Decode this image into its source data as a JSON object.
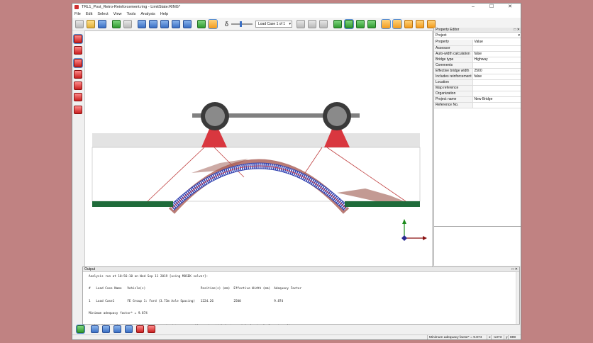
{
  "window": {
    "title": "TRL1_Post_Retro-Reinforcement.ring - LimitState:RING*",
    "controls": [
      "–",
      "☐",
      "✕"
    ]
  },
  "menu": [
    "File",
    "Edit",
    "Select",
    "View",
    "Tools",
    "Analysis",
    "Help"
  ],
  "toolbar": {
    "slider_label": "δ",
    "load_case": "Load Case 1 of 1"
  },
  "property_editor": {
    "title": "Property Editor",
    "header_controls": "□ ✕",
    "object": "Project",
    "columns": [
      "Property",
      "Value"
    ],
    "rows": [
      {
        "property": "Assessor",
        "value": ""
      },
      {
        "property": "Auto-width calculation",
        "value": "false"
      },
      {
        "property": "Bridge type",
        "value": "Highway"
      },
      {
        "property": "Comments",
        "value": ""
      },
      {
        "property": "Effective bridge width",
        "value": "2500"
      },
      {
        "property": "Includes reinforcement",
        "value": "false"
      },
      {
        "property": "Location",
        "value": ""
      },
      {
        "property": "Map reference",
        "value": ""
      },
      {
        "property": "Organization",
        "value": ""
      },
      {
        "property": "Project name",
        "value": "New Bridge"
      },
      {
        "property": "Reference No.",
        "value": ""
      }
    ]
  },
  "output": {
    "title": "Output",
    "header_controls": "□ ✕",
    "lines": [
      "Analysis run at 10:56:10 on Wed Sep 11 2019 [using MOSEK solver]:",
      "",
      "#   Load Case Name   Vehicle(s)                              Position(s) (mm)  Effective Width (mm)  Adequacy Factor",
      "",
      "1   Load Case1       FE Group 1: Ford (3.73m Axle Spacing)   1224.26           2500                  9.874",
      "",
      "Minimum adequacy factor* = 9.874",
      "",
      "*multiplier on factored vehicle loads required to cause collapse (partial factors: Axle load = 1, Dynamic = 1)"
    ]
  },
  "status": {
    "adequacy": "Minimum adequacy factor* = 9.874",
    "x_label": "x:",
    "x_value": "-1373",
    "y_label": "y:",
    "y_value": "889"
  },
  "colors": {
    "background": "#c08282",
    "load_patch": "#d9373f",
    "ground": "#1f6b3a",
    "soil": "#e3e3e3",
    "vehicle": "#808080",
    "arch_outline": "#3040b0",
    "deformation": "#9a5048"
  }
}
